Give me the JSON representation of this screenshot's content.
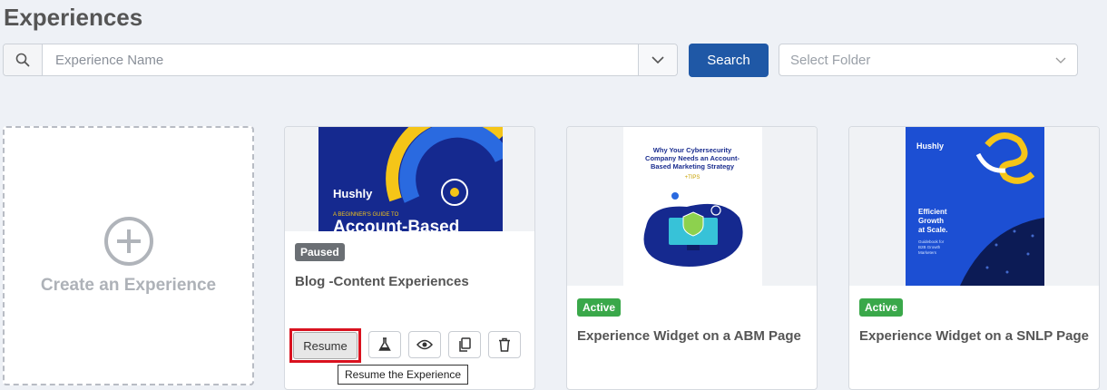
{
  "header": {
    "title": "Experiences"
  },
  "search": {
    "placeholder": "Experience Name",
    "button_label": "Search"
  },
  "folder": {
    "placeholder": "Select Folder"
  },
  "create": {
    "label": "Create an Experience"
  },
  "cards": [
    {
      "status": "Paused",
      "title": "Blog -Content Experiences",
      "thumb": {
        "brand": "Hushly",
        "kicker": "A BEGINNER'S GUIDE TO",
        "headline": "Account-Based"
      },
      "actions": {
        "resume_label": "Resume"
      }
    },
    {
      "status": "Active",
      "title": "Experience Widget on a ABM Page",
      "thumb": {
        "line1": "Why Your Cybersecurity",
        "line2": "Company Needs an Account-",
        "line3": "Based Marketing Strategy",
        "tag": "+TIPS"
      }
    },
    {
      "status": "Active",
      "title": "Experience Widget on a SNLP Page",
      "thumb": {
        "brand": "Hushly",
        "line1": "Efficient",
        "line2": "Growth",
        "line3": "at Scale.",
        "sub1": "Guidebook for",
        "sub2": "B2B Growth",
        "sub3": "Marketers"
      }
    }
  ],
  "tooltip": {
    "text": "Resume the Experience"
  },
  "colors": {
    "primary": "#1f58a6",
    "active": "#3aa84a",
    "paused": "#6b6f74",
    "highlight": "#d9121f"
  }
}
